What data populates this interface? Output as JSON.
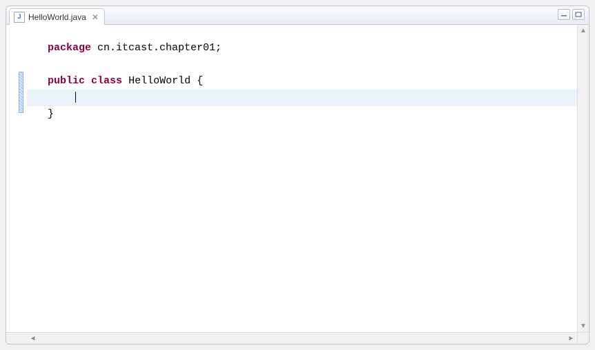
{
  "tab": {
    "filename": "HelloWorld.java",
    "icon_letter": "J"
  },
  "code": {
    "line1_keyword": "package",
    "line1_rest": " cn.itcast.chapter01;",
    "line3_keyword1": "public",
    "line3_keyword2": "class",
    "line3_space1": " ",
    "line3_space2": " ",
    "line3_classname": "HelloWorld",
    "line3_rest": " {",
    "line4_indent": "    ",
    "line5": "}"
  }
}
